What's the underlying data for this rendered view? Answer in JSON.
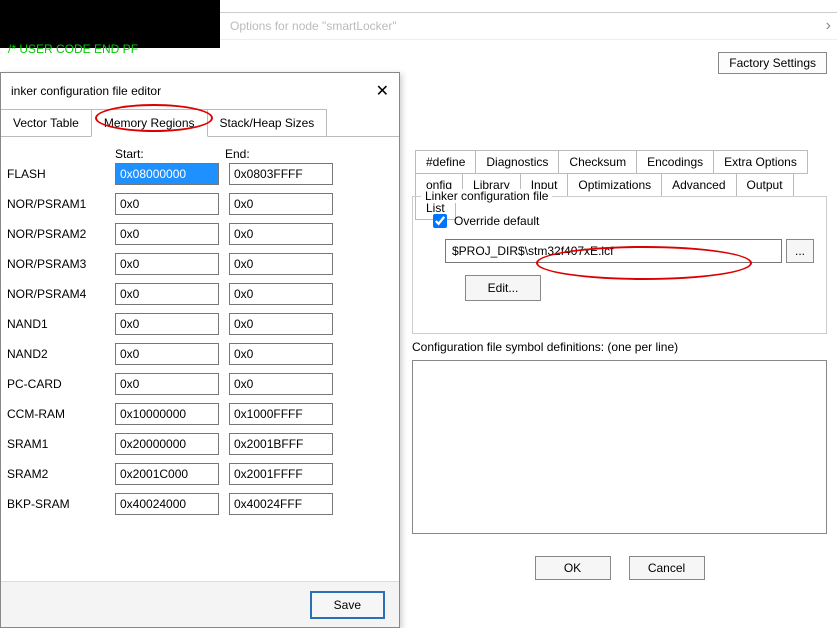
{
  "code_bg": {
    "line1": "/* USER CODE END PF",
    "line0": ""
  },
  "options_bar": {
    "text": "Options for node \"smartLocker\""
  },
  "dialog": {
    "title": "inker configuration file editor",
    "tabs": {
      "t0": "Vector Table",
      "t1": "Memory Regions",
      "t2": "Stack/Heap Sizes"
    },
    "headers": {
      "start": "Start:",
      "end": "End:"
    },
    "rows": [
      {
        "label": "FLASH",
        "start": "0x08000000",
        "end": "0x0803FFFF",
        "sel": true
      },
      {
        "label": "NOR/PSRAM1",
        "start": "0x0",
        "end": "0x0"
      },
      {
        "label": "NOR/PSRAM2",
        "start": "0x0",
        "end": "0x0"
      },
      {
        "label": "NOR/PSRAM3",
        "start": "0x0",
        "end": "0x0"
      },
      {
        "label": "NOR/PSRAM4",
        "start": "0x0",
        "end": "0x0"
      },
      {
        "label": "NAND1",
        "start": "0x0",
        "end": "0x0"
      },
      {
        "label": "NAND2",
        "start": "0x0",
        "end": "0x0"
      },
      {
        "label": "PC-CARD",
        "start": "0x0",
        "end": "0x0"
      },
      {
        "label": "CCM-RAM",
        "start": "0x10000000",
        "end": "0x1000FFFF"
      },
      {
        "label": "SRAM1",
        "start": "0x20000000",
        "end": "0x2001BFFF"
      },
      {
        "label": "SRAM2",
        "start": "0x2001C000",
        "end": "0x2001FFFF"
      },
      {
        "label": "BKP-SRAM",
        "start": "0x40024000",
        "end": "0x40024FFF"
      }
    ],
    "save": "Save"
  },
  "right": {
    "factory": "Factory Settings",
    "tabs1": {
      "a": "#define",
      "b": "Diagnostics",
      "c": "Checksum",
      "d": "Encodings",
      "e": "Extra Options"
    },
    "tabs2": {
      "a": "onfig",
      "b": "Library",
      "c": "Input",
      "d": "Optimizations",
      "e": "Advanced",
      "f": "Output",
      "g": "List"
    },
    "group_legend": "Linker configuration file",
    "override": "Override default",
    "path": "$PROJ_DIR$\\stm32f407xE.icf",
    "dots": "...",
    "edit": "Edit...",
    "symdef_label": "Configuration file symbol definitions: (one per line)",
    "ok": "OK",
    "cancel": "Cancel"
  }
}
